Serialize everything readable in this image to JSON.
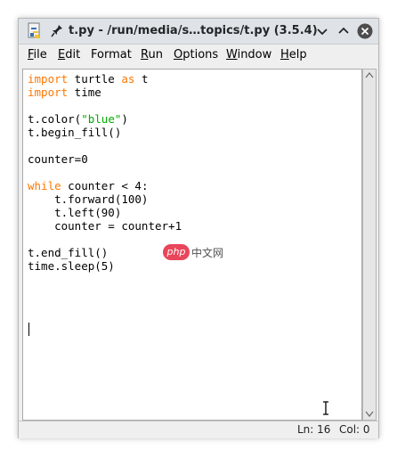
{
  "window": {
    "title": "t.py - /run/media/s…topics/t.py (3.5.4)"
  },
  "menu": {
    "items": [
      {
        "accel": "F",
        "rest": "ile"
      },
      {
        "accel": "E",
        "rest": "dit"
      },
      {
        "accel": "",
        "rest": "Format"
      },
      {
        "accel": "R",
        "rest": "un"
      },
      {
        "accel": "O",
        "rest": "ptions"
      },
      {
        "accel": "W",
        "rest": "indow"
      },
      {
        "accel": "H",
        "rest": "elp"
      }
    ]
  },
  "editor": {
    "lines": [
      [
        {
          "t": "import",
          "k": "kw"
        },
        {
          "t": " turtle ",
          "k": ""
        },
        {
          "t": "as",
          "k": "kw"
        },
        {
          "t": " t",
          "k": ""
        }
      ],
      [
        {
          "t": "import",
          "k": "kw"
        },
        {
          "t": " time",
          "k": ""
        }
      ],
      [],
      [
        {
          "t": "t.color(",
          "k": ""
        },
        {
          "t": "\"blue\"",
          "k": "str"
        },
        {
          "t": ")",
          "k": ""
        }
      ],
      [
        {
          "t": "t.begin_fill()",
          "k": ""
        }
      ],
      [],
      [
        {
          "t": "counter=0",
          "k": ""
        }
      ],
      [],
      [
        {
          "t": "while",
          "k": "kw"
        },
        {
          "t": " counter < 4:",
          "k": ""
        }
      ],
      [
        {
          "t": "    t.forward(100)",
          "k": ""
        }
      ],
      [
        {
          "t": "    t.left(90)",
          "k": ""
        }
      ],
      [
        {
          "t": "    counter = counter+1",
          "k": ""
        }
      ],
      [],
      [
        {
          "t": "t.end_fill()",
          "k": ""
        }
      ],
      [
        {
          "t": "time.sleep(5)",
          "k": ""
        }
      ],
      []
    ],
    "colors": {
      "keyword": "#ff7700",
      "string": "#00aa00"
    }
  },
  "watermark": {
    "badge": "php",
    "text": "中文网"
  },
  "status": {
    "line": "Ln: 16",
    "col": "Col: 0"
  }
}
